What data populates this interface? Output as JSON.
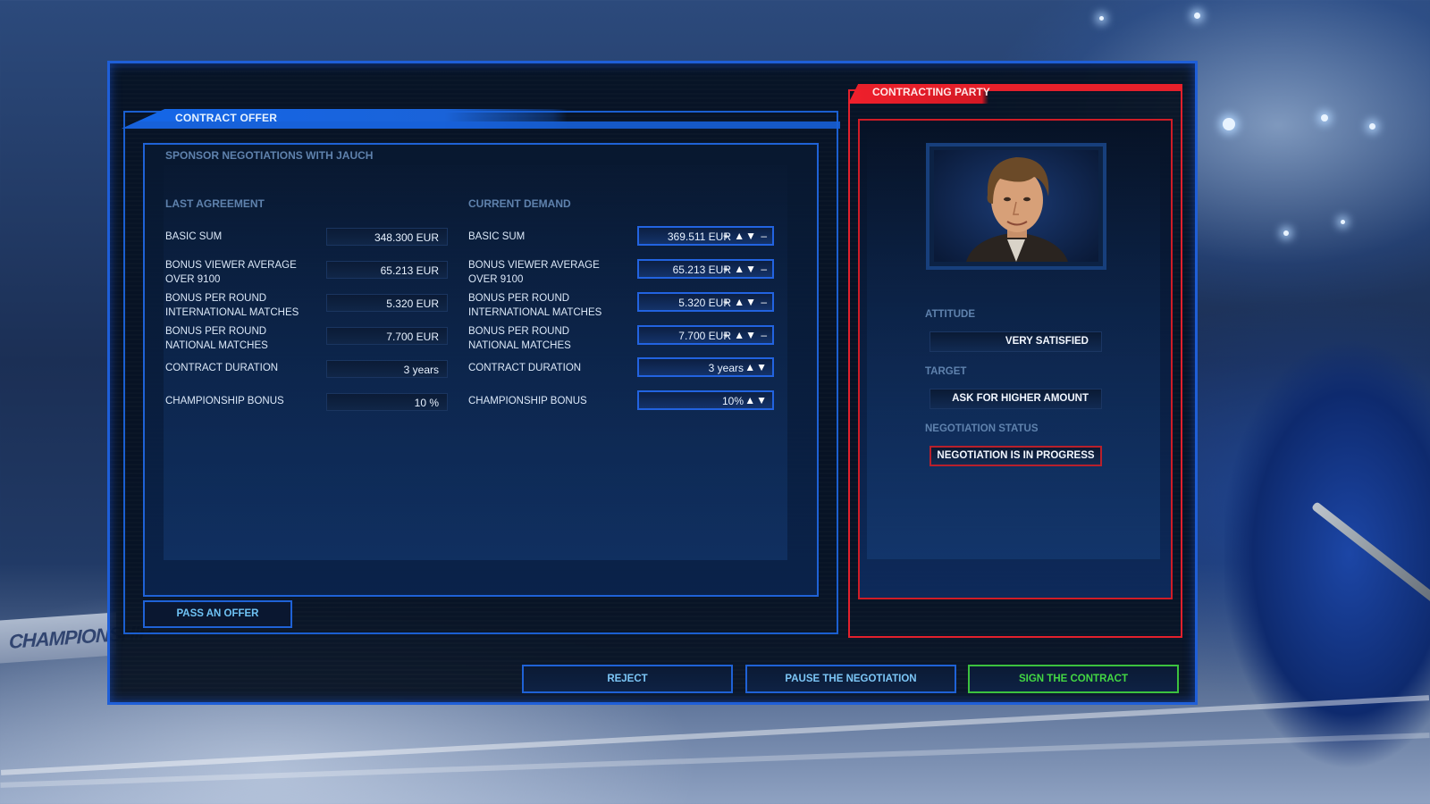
{
  "background": {
    "board_text": "CHAMPIONSHIP"
  },
  "offer": {
    "header": "CONTRACT OFFER",
    "subtitle": "SPONSOR NEGOTIATIONS WITH JAUCH",
    "last_agreement_title": "LAST AGREEMENT",
    "current_demand_title": "CURRENT DEMAND",
    "rows": [
      {
        "label": "BASIC SUM",
        "last": "348.300 EUR",
        "current": "369.511 EUR",
        "controls": "+ ▲▼ –"
      },
      {
        "label": "BONUS VIEWER AVERAGE OVER 9100",
        "last": "65.213 EUR",
        "current": "65.213 EUR",
        "controls": "+ ▲▼ –"
      },
      {
        "label": "BONUS PER ROUND INTERNATIONAL MATCHES",
        "last": "5.320 EUR",
        "current": "5.320 EUR",
        "controls": "+ ▲▼ –"
      },
      {
        "label": "BONUS PER ROUND NATIONAL MATCHES",
        "last": "7.700 EUR",
        "current": "7.700 EUR",
        "controls": "+ ▲▼ –"
      },
      {
        "label": "CONTRACT DURATION",
        "last": "3 years",
        "current": "3 years",
        "controls": "▲▼"
      },
      {
        "label": "CHAMPIONSHIP BONUS",
        "last": "10 %",
        "current": "10%",
        "controls": "▲▼"
      }
    ],
    "pass_button": "PASS AN OFFER"
  },
  "party": {
    "header": "CONTRACTING PARTY",
    "attitude_label": "ATTITUDE",
    "attitude_value": "VERY SATISFIED",
    "target_label": "TARGET",
    "target_value": "ASK FOR HIGHER AMOUNT",
    "status_label": "NEGOTIATION STATUS",
    "status_value": "NEGOTIATION IS IN PROGRESS"
  },
  "actions": {
    "reject": "REJECT",
    "pause": "PAUSE THE NEGOTIATION",
    "sign": "SIGN THE CONTRACT"
  },
  "colors": {
    "accent_blue": "#1f62d6",
    "accent_red": "#e3202c",
    "accent_green": "#3cc13f"
  }
}
